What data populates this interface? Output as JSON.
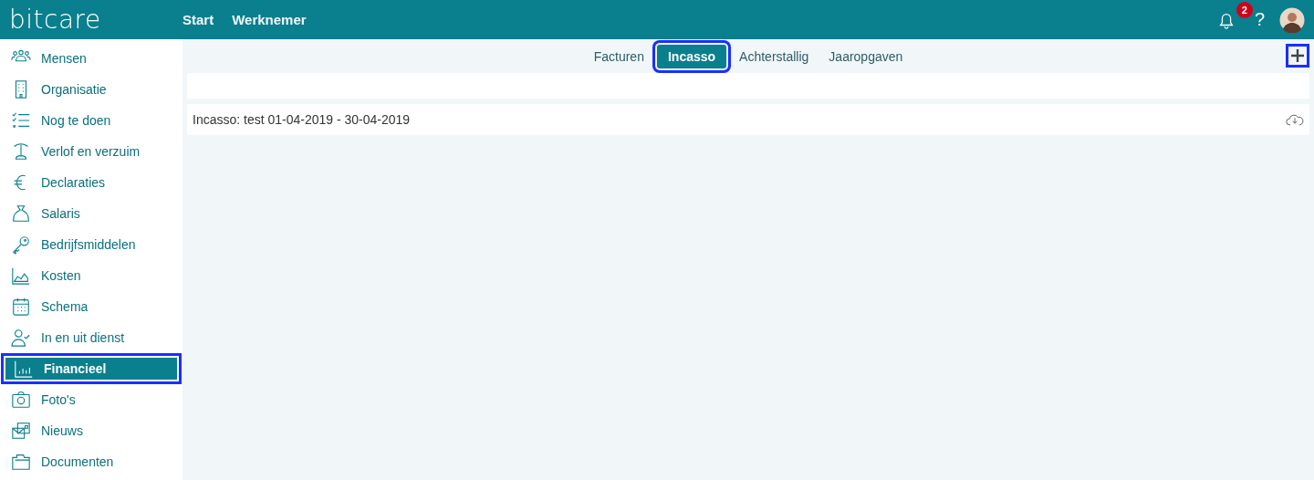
{
  "topbar": {
    "logo": "bitcare",
    "nav": [
      {
        "label": "Start"
      },
      {
        "label": "Werknemer"
      }
    ],
    "notifications": "2",
    "help": "?"
  },
  "sidebar": {
    "items": [
      {
        "label": "Mensen",
        "selected": false,
        "highlighted": false
      },
      {
        "label": "Organisatie",
        "selected": false,
        "highlighted": false
      },
      {
        "label": "Nog te doen",
        "selected": false,
        "highlighted": false
      },
      {
        "label": "Verlof en verzuim",
        "selected": false,
        "highlighted": false
      },
      {
        "label": "Declaraties",
        "selected": false,
        "highlighted": false
      },
      {
        "label": "Salaris",
        "selected": false,
        "highlighted": false
      },
      {
        "label": "Bedrijfsmiddelen",
        "selected": false,
        "highlighted": false
      },
      {
        "label": "Kosten",
        "selected": false,
        "highlighted": false
      },
      {
        "label": "Schema",
        "selected": false,
        "highlighted": false
      },
      {
        "label": "In en uit dienst",
        "selected": false,
        "highlighted": false
      },
      {
        "label": "Financieel",
        "selected": true,
        "highlighted": true
      },
      {
        "label": "Foto's",
        "selected": false,
        "highlighted": false
      },
      {
        "label": "Nieuws",
        "selected": false,
        "highlighted": false
      },
      {
        "label": "Documenten",
        "selected": false,
        "highlighted": false
      }
    ]
  },
  "tabs": [
    {
      "label": "Facturen",
      "selected": false,
      "highlighted": false
    },
    {
      "label": "Incasso",
      "selected": true,
      "highlighted": true
    },
    {
      "label": "Achterstallig",
      "selected": false,
      "highlighted": false
    },
    {
      "label": "Jaaropgaven",
      "selected": false,
      "highlighted": false
    }
  ],
  "add_button": {
    "highlighted": true
  },
  "rows": [
    {
      "title": "Incasso: test 01-04-2019 - 30-04-2019"
    }
  ]
}
